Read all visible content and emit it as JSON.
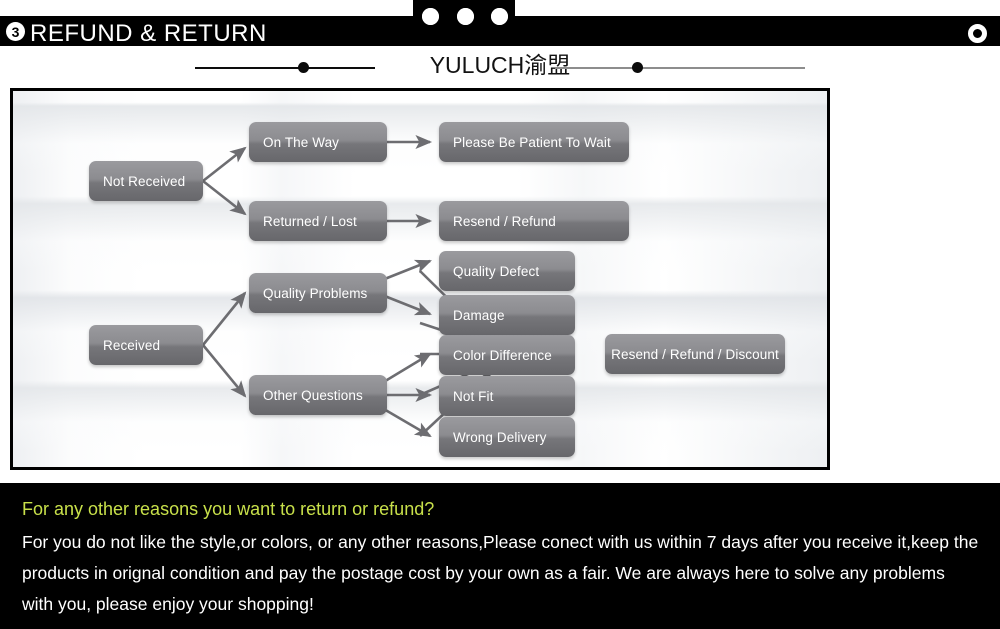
{
  "header": {
    "badge": "3",
    "title": "REFUND & RETURN",
    "dots_icon": "circle-dot-icon",
    "corner_icon": "ring-icon"
  },
  "brand": {
    "text": "YULUCH渝盟"
  },
  "diagram": {
    "nodes": {
      "not_received": "Not Received",
      "received": "Received",
      "on_the_way": "On The Way",
      "returned_lost": "Returned / Lost",
      "quality_problems": "Quality Problems",
      "other_questions": "Other Questions",
      "please_wait": "Please Be Patient To Wait",
      "resend_refund": "Resend / Refund",
      "quality_defect": "Quality Defect",
      "damage": "Damage",
      "color_difference": "Color Difference",
      "not_fit": "Not Fit",
      "wrong_delivery": "Wrong Delivery",
      "resend_refund_discount": "Resend / Refund / Discount"
    }
  },
  "notes": {
    "title": "For any other reasons you want to return or refund?",
    "body": "For you do not like the style,or colors, or any other reasons,Please conect with us within 7 days after you receive it,keep the products in orignal condition and pay the postage cost by your own as a fair. We are always here to solve any problems with you, please enjoy your shopping!"
  },
  "colors": {
    "accent_yellow": "#c8e04a",
    "node_gray": "#8c8c90",
    "header_black": "#000000"
  }
}
